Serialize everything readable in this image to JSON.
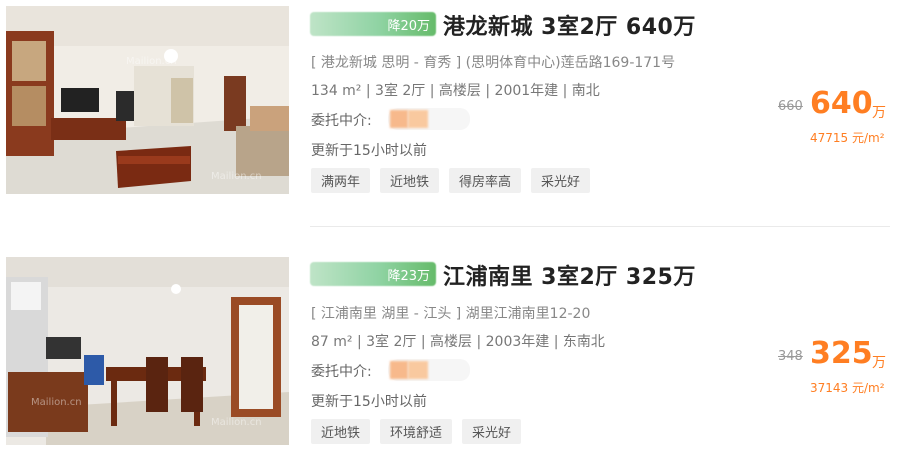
{
  "listings": [
    {
      "badge": "降20万",
      "title": "港龙新城 3室2厅 640万",
      "address": "[ 港龙新城 思明 - 育秀 ] (思明体育中心)莲岳路169-171号",
      "details": "134 m² | 3室 2厅 | 高楼层 | 2001年建 | 南北",
      "agent_label": "委托中介:",
      "updated": "更新于15小时以前",
      "tags": [
        "满两年",
        "近地铁",
        "得房率高",
        "采光好"
      ],
      "old_price": "660",
      "price": "640",
      "price_unit": "万",
      "unit_price": "47715 元/m²",
      "watermark": "Mailion.cn"
    },
    {
      "badge": "降23万",
      "title": "江浦南里 3室2厅 325万",
      "address": "[ 江浦南里 湖里 - 江头 ] 湖里江浦南里12-20",
      "details": "87 m² | 3室 2厅 | 高楼层 | 2003年建 | 东南北",
      "agent_label": "委托中介:",
      "updated": "更新于15小时以前",
      "tags": [
        "近地铁",
        "环境舒适",
        "采光好"
      ],
      "old_price": "348",
      "price": "325",
      "price_unit": "万",
      "unit_price": "37143 元/m²",
      "watermark": "Mailion.cn"
    }
  ]
}
